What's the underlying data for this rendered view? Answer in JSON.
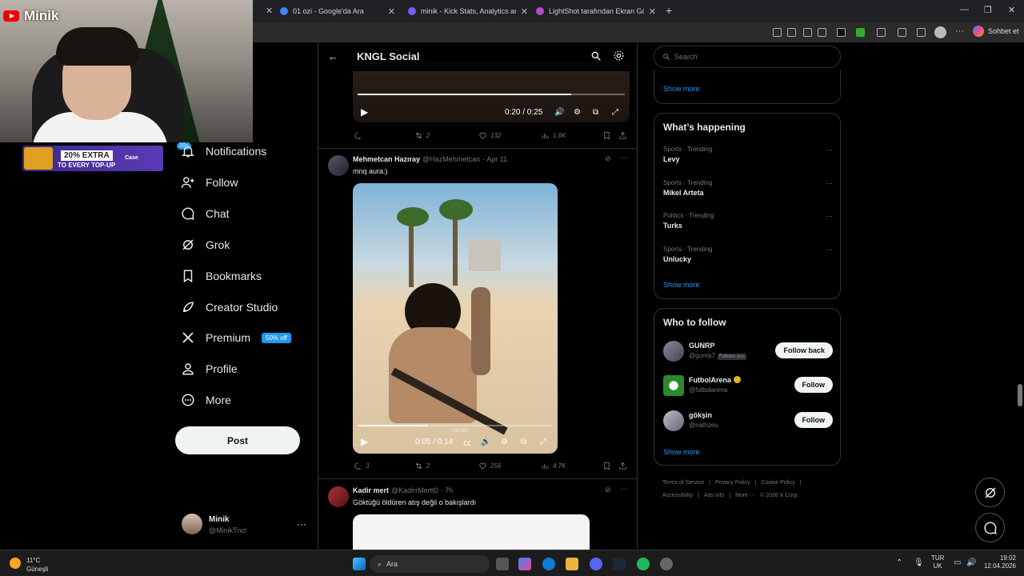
{
  "browser": {
    "tabs": [
      {
        "title": "01 ozi - Google'da Ara",
        "icon": "google-icon",
        "color": "#4285f4"
      },
      {
        "title": "minik - Kick Stats, Analytics and C",
        "icon": "stats-icon",
        "color": "#7c5cff"
      },
      {
        "title": "LightShot tarafından Ekran Görünt",
        "icon": "lightshot-icon",
        "color": "#b04cd0"
      }
    ],
    "new_tab": "+",
    "chat_button": "Sohbet et"
  },
  "stream": {
    "channel_name": "Minik",
    "ad": {
      "line1": "20% EXTRA",
      "line2": "TO EVERY TOP-UP",
      "brand": "Case"
    }
  },
  "nav": {
    "notifications_badge": "20+",
    "items": [
      {
        "label": "Notifications",
        "icon": "bell-icon"
      },
      {
        "label": "Follow",
        "icon": "follow-icon"
      },
      {
        "label": "Chat",
        "icon": "chat-icon"
      },
      {
        "label": "Grok",
        "icon": "grok-icon"
      },
      {
        "label": "Bookmarks",
        "icon": "bookmark-icon"
      },
      {
        "label": "Creator Studio",
        "icon": "rocket-icon"
      },
      {
        "label": "Premium",
        "icon": "x-logo-icon"
      },
      {
        "label": "Profile",
        "icon": "person-icon"
      },
      {
        "label": "More",
        "icon": "more-circle-icon"
      }
    ],
    "premium_badge": "50% off",
    "post_button": "Post",
    "account": {
      "name": "Minik",
      "handle": "@MinikTncl"
    }
  },
  "header": {
    "title": "KNGL Social"
  },
  "feed": {
    "top_video": {
      "time": "0:20 / 0:25",
      "progress": 0.8
    },
    "top_actions": {
      "replies": "",
      "reposts": "2",
      "likes": "132",
      "views": "1.8K"
    },
    "tweets": [
      {
        "name": "Mehmetcan Hazıray",
        "handle": "@HazMehmetcan",
        "date": "· Apr 11",
        "text": "mnq aura:)",
        "video_time": "0:05 / 0:14",
        "video_progress": 0.36,
        "watermark": "mcan",
        "actions": {
          "replies": "3",
          "reposts": "2",
          "likes": "256",
          "views": "4.7K"
        }
      },
      {
        "name": "Kadir mert",
        "handle": "@KadirrMertt0",
        "date": "· 7h",
        "text": "Göktüğü öldüren atış değil o bakışlardı"
      }
    ]
  },
  "sidebar": {
    "search_placeholder": "Search",
    "show_more": "Show more",
    "trends_title": "What’s happening",
    "trends": [
      {
        "category": "Sports · Trending",
        "name": "Levy"
      },
      {
        "category": "Sports · Trending",
        "name": "Mikel Arteta"
      },
      {
        "category": "Politics · Trending",
        "name": "Turks"
      },
      {
        "category": "Sports · Trending",
        "name": "Unlucky"
      }
    ],
    "wtf_title": "Who to follow",
    "who_to_follow": [
      {
        "name": "GUNRP",
        "handle": "@gunrp7",
        "follows_you": "Follows you",
        "button": "Follow back"
      },
      {
        "name": "FutbolArena",
        "handle": "@futbolarena",
        "follows_you": "",
        "button": "Follow"
      },
      {
        "name": "gökşin",
        "handle": "@nathzeu",
        "follows_you": "",
        "button": "Follow"
      }
    ],
    "footer": [
      "Terms of Service",
      "|",
      "Privacy Policy",
      "|",
      "Cookie Policy",
      "|",
      "Accessibility",
      "|",
      "Ads info",
      "|",
      "More ···",
      "© 2026 X Corp."
    ]
  },
  "taskbar": {
    "weather_temp": "11°C",
    "weather_desc": "Güneşli",
    "search": "Ara",
    "lang_top": "TUR",
    "lang_bottom": "UK",
    "time": "19:02",
    "date": "12.04.2026"
  }
}
